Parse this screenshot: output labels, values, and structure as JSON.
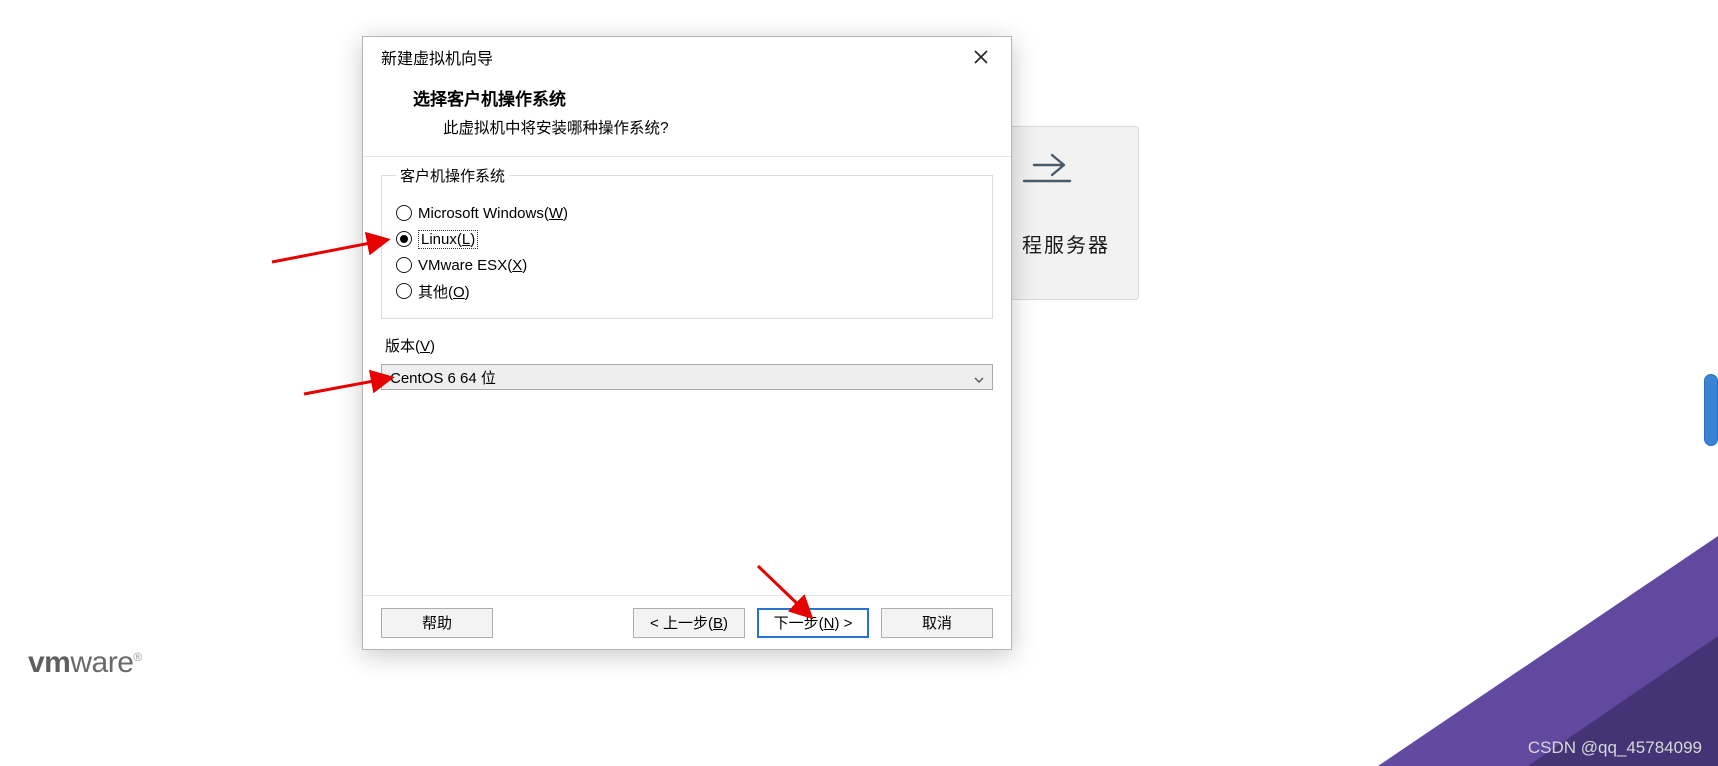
{
  "dialog": {
    "title": "新建虚拟机向导",
    "heading": "选择客户机操作系统",
    "subheading": "此虚拟机中将安装哪种操作系统?"
  },
  "os_group": {
    "legend": "客户机操作系统",
    "options": [
      {
        "label_pre": "Microsoft Windows(",
        "hotkey": "W",
        "label_post": ")",
        "selected": false
      },
      {
        "label_pre": "Linux(",
        "hotkey": "L",
        "label_post": ")",
        "selected": true
      },
      {
        "label_pre": "VMware ESX(",
        "hotkey": "X",
        "label_post": ")",
        "selected": false
      },
      {
        "label_pre": "其他(",
        "hotkey": "O",
        "label_post": ")",
        "selected": false
      }
    ]
  },
  "version": {
    "label_pre": "版本(",
    "hotkey": "V",
    "label_post": ")",
    "selected": "CentOS 6 64 位"
  },
  "buttons": {
    "help": "帮助",
    "back_pre": "< 上一步(",
    "back_hot": "B",
    "back_post": ")",
    "next_pre": "下一步(",
    "next_hot": "N",
    "next_post": ") >",
    "cancel": "取消"
  },
  "bg_card": {
    "text": "程服务器"
  },
  "logo": {
    "vm": "vm",
    "ware": "ware"
  },
  "watermark": "CSDN @qq_45784099"
}
